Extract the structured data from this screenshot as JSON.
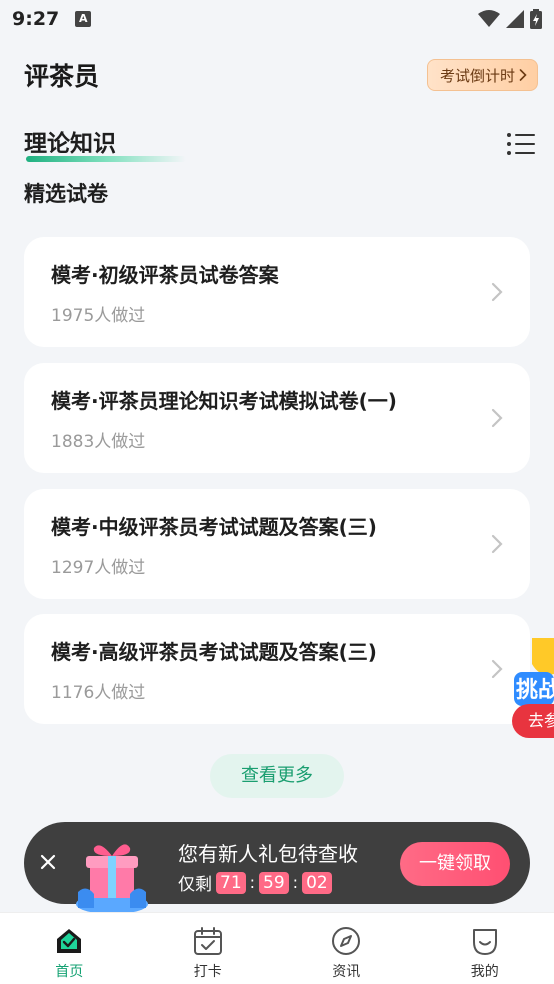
{
  "status": {
    "time": "9:27"
  },
  "header": {
    "title": "评茶员",
    "countdown_label": "考试倒计时"
  },
  "section": {
    "title": "理论知识",
    "subtitle": "精选试卷"
  },
  "papers": [
    {
      "title": "模考·初级评茶员试卷答案",
      "count": "1975人做过"
    },
    {
      "title": "模考·评茶员理论知识考试模拟试卷(一)",
      "count": "1883人做过"
    },
    {
      "title": "模考·中级评茶员考试试题及答案(三)",
      "count": "1297人做过"
    },
    {
      "title": "模考·高级评茶员考试试题及答案(三)",
      "count": "1176人做过"
    }
  ],
  "more_label": "查看更多",
  "floating": {
    "badge_text": "挑战",
    "go_label": "去参"
  },
  "promo": {
    "text": "您有新人礼包待查收",
    "remaining_label": "仅剩",
    "hours": "71",
    "minutes": "59",
    "seconds": "02",
    "claim_label": "一键领取"
  },
  "tabs": [
    {
      "label": "首页",
      "icon": "home-icon",
      "active": true
    },
    {
      "label": "打卡",
      "icon": "calendar-check-icon",
      "active": false
    },
    {
      "label": "资讯",
      "icon": "compass-icon",
      "active": false
    },
    {
      "label": "我的",
      "icon": "profile-icon",
      "active": false
    }
  ],
  "colors": {
    "accent": "#15a273",
    "promo_pink": "#ff5a7a",
    "countdown_bg": "#ffd6b0"
  }
}
